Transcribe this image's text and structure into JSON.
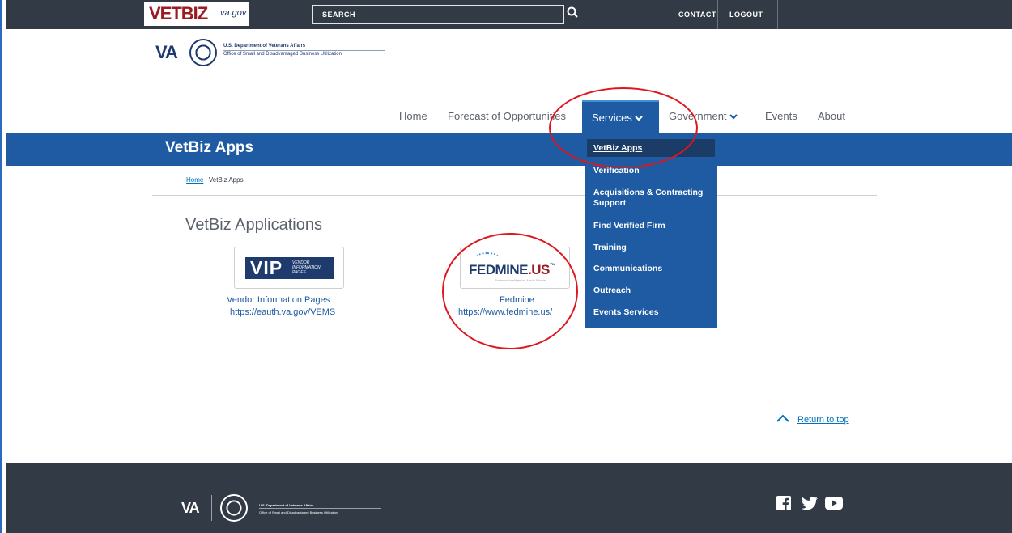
{
  "header": {
    "logo_text": "VETBIZ",
    "logo_domain": "va.gov",
    "search_placeholder": "SEARCH",
    "links": [
      "CONTACT",
      "LOGOUT"
    ]
  },
  "agency": {
    "mark": "VA",
    "line1": "U.S. Department of Veterans Affairs",
    "line2": "Office of Small and Disadvantaged Business Utilization"
  },
  "nav": {
    "home": "Home",
    "forecast": "Forecast of Opportunities",
    "services": "Services",
    "government": "Government",
    "events": "Events",
    "about": "About"
  },
  "page": {
    "banner_title": "VetBiz Apps",
    "breadcrumb_home": "Home",
    "breadcrumb_sep": " | ",
    "breadcrumb_current": "VetBiz Apps",
    "section_title": "VetBiz Applications"
  },
  "apps": [
    {
      "logo": "VIP",
      "logo_sub": "VENDOR INFORMATION PAGES",
      "title": "Vendor Information Pages",
      "url": "https://eauth.va.gov/VEMS"
    },
    {
      "logo": "FEDMINE",
      "logo_suffix": ".US",
      "logo_tm": "™",
      "logo_tag": "Business Intelligence. Made Simple.",
      "title": "Fedmine",
      "url": "https://www.fedmine.us/"
    }
  ],
  "services_menu": [
    "VetBiz Apps",
    "Verification",
    "Acquisitions & Contracting Support",
    "Find Verified Firm",
    "Training",
    "Communications",
    "Outreach",
    "Events Services"
  ],
  "footer": {
    "mark": "VA",
    "line1": "U.S. Department of Veterans Affairs",
    "line2": "Office of Small and Disadvantaged Business Utilization",
    "return_to_top": "Return to top",
    "social": [
      "facebook-icon",
      "twitter-icon",
      "youtube-icon"
    ]
  },
  "colors": {
    "dark": "#323a45",
    "primary": "#1f5ba2",
    "annotation": "#e0161e"
  }
}
